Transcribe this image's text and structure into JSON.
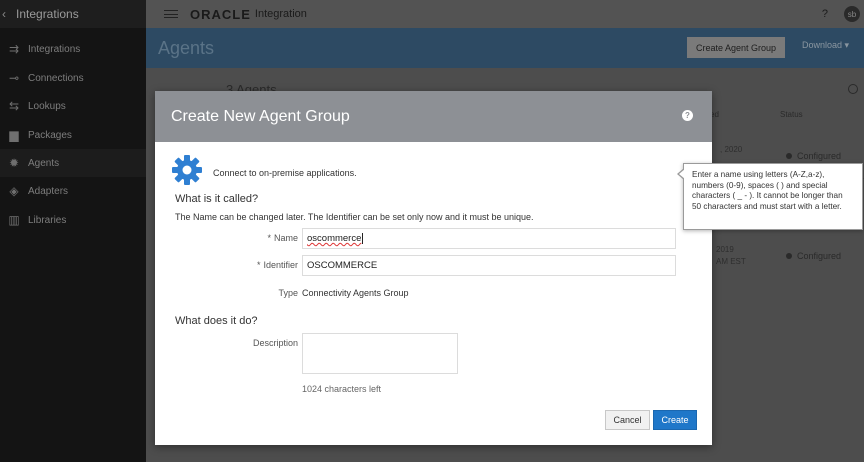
{
  "sidebar": {
    "title": "Integrations",
    "items": [
      {
        "label": "Integrations",
        "icon": "integrations-icon"
      },
      {
        "label": "Connections",
        "icon": "connections-icon"
      },
      {
        "label": "Lookups",
        "icon": "lookups-icon"
      },
      {
        "label": "Packages",
        "icon": "folder-icon"
      },
      {
        "label": "Agents",
        "icon": "gear-icon"
      },
      {
        "label": "Adapters",
        "icon": "adapters-icon"
      },
      {
        "label": "Libraries",
        "icon": "libraries-icon"
      }
    ]
  },
  "topbar": {
    "brand": "ORACLE",
    "product": "Integration",
    "help": "?",
    "avatar": "sb"
  },
  "page": {
    "title": "Agents",
    "create_group_label": "Create Agent Group",
    "download_label": "Download"
  },
  "list": {
    "count": "3 Agents",
    "col_status": "Status",
    "col_updated": "ed",
    "rows": [
      {
        "date": ", 2020",
        "status": "Configured"
      },
      {
        "date": "2019",
        "time": "AM EST",
        "status": "Configured"
      }
    ]
  },
  "modal": {
    "title": "Create New Agent Group",
    "help_icon": "?",
    "intro": "Connect to on-premise applications.",
    "section1_title": "What is it called?",
    "section1_sub": "The Name can be changed later. The Identifier can be set only now and it must be unique.",
    "name_label": "Name",
    "name_value": "oscommerce",
    "identifier_label": "Identifier",
    "identifier_value": "OSCOMMERCE",
    "type_label": "Type",
    "type_value": "Connectivity Agents Group",
    "section2_title": "What does it do?",
    "description_label": "Description",
    "chars_left": "1024 characters left",
    "cancel_label": "Cancel",
    "create_label": "Create"
  },
  "tooltip": {
    "text": "Enter a name using letters (A-Z,a-z), numbers (0-9), spaces ( ) and special characters ( _ - ). It cannot be longer than 50 characters and must start with a letter."
  },
  "colors": {
    "modal_header": "#8d9095",
    "primary_button": "#1f77c9",
    "page_header": "#2d4a63"
  }
}
